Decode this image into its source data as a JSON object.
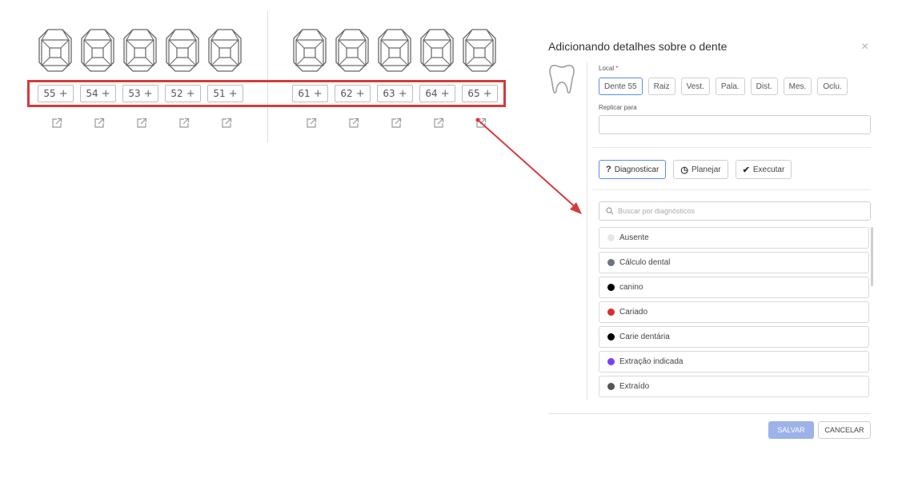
{
  "odontogram": {
    "upper_left": [
      {
        "number": "55",
        "plus": "+"
      },
      {
        "number": "54",
        "plus": "+"
      },
      {
        "number": "53",
        "plus": "+"
      },
      {
        "number": "52",
        "plus": "+"
      },
      {
        "number": "51",
        "plus": "+"
      }
    ],
    "upper_right": [
      {
        "number": "61",
        "plus": "+"
      },
      {
        "number": "62",
        "plus": "+"
      },
      {
        "number": "63",
        "plus": "+"
      },
      {
        "number": "64",
        "plus": "+"
      },
      {
        "number": "65",
        "plus": "+"
      }
    ]
  },
  "panel": {
    "title": "Adicionando detalhes sobre o dente",
    "close_glyph": "×",
    "local_label": "Local",
    "required_mark": "*",
    "local_options": [
      "Dente 55",
      "Raiz",
      "Vest.",
      "Pala.",
      "Dist.",
      "Mes.",
      "Oclu."
    ],
    "replicar_label": "Replicar para",
    "actions": [
      {
        "icon": "?",
        "label": "Diagnosticar"
      },
      {
        "icon": "◷",
        "label": "Planejar"
      },
      {
        "icon": "✔",
        "label": "Executar"
      }
    ],
    "search_placeholder": "Buscar por diagnósticos",
    "diagnoses": [
      {
        "label": "Ausente",
        "color": "#e6e6e6"
      },
      {
        "label": "Cálculo dental",
        "color": "#6c757d"
      },
      {
        "label": "canino",
        "color": "#000000"
      },
      {
        "label": "Cariado",
        "color": "#d9302c"
      },
      {
        "label": "Carie dentária",
        "color": "#000000"
      },
      {
        "label": "Extração indicada",
        "color": "#7b3ff2"
      },
      {
        "label": "Extraído",
        "color": "#555555"
      }
    ],
    "save_label": "SALVAR",
    "cancel_label": "CANCELAR"
  },
  "colors": {
    "highlight": "#d63a3a",
    "accent": "#5a8dee",
    "save_button": "#9cb2e8"
  }
}
